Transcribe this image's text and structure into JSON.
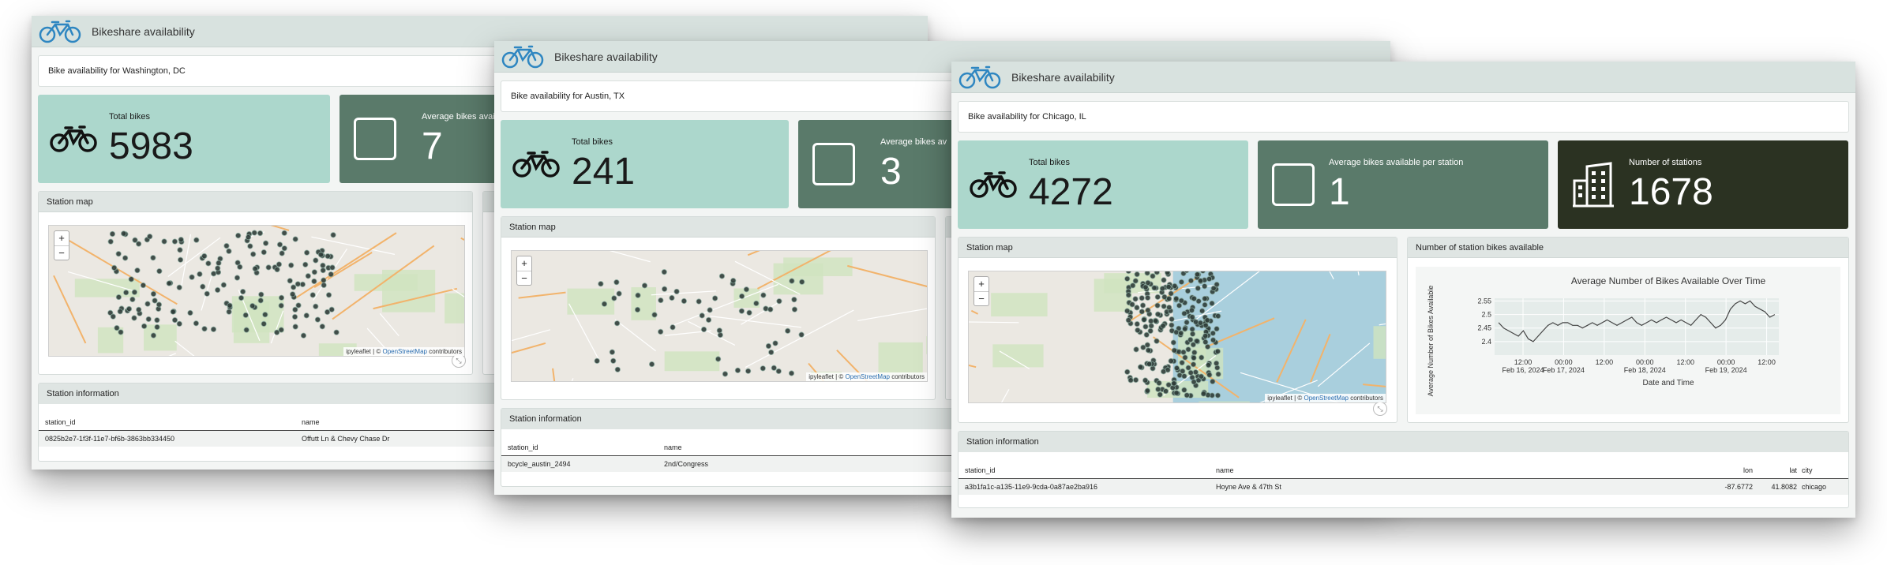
{
  "app": {
    "title": "Bikeshare availability"
  },
  "windows": {
    "dc": {
      "city_label": "Bike availability for Washington, DC",
      "cards": {
        "total_label": "Total bikes",
        "total_value": "5983",
        "avg_label": "Average bikes available per station",
        "avg_value": "7"
      },
      "map_title": "Station map",
      "table": {
        "title": "Station information",
        "columns": [
          "station_id",
          "name"
        ],
        "rows": [
          [
            "0825b2e7-1f3f-11e7-bf6b-3863bb334450",
            "Offutt Ln & Chevy Chase Dr"
          ]
        ]
      }
    },
    "austin": {
      "city_label": "Bike availability for Austin, TX",
      "cards": {
        "total_label": "Total bikes",
        "total_value": "241",
        "avg_label": "Average bikes av",
        "avg_value": "3"
      },
      "map_title": "Station map",
      "table": {
        "title": "Station information",
        "columns": [
          "station_id",
          "name"
        ],
        "rows": [
          [
            "bcycle_austin_2494",
            "2nd/Congress"
          ]
        ]
      }
    },
    "chicago": {
      "city_label": "Bike availability for Chicago, IL",
      "cards": {
        "total_label": "Total bikes",
        "total_value": "4272",
        "avg_label": "Average bikes available per station",
        "avg_value": "1",
        "stations_label": "Number of stations",
        "stations_value": "1678"
      },
      "map_title": "Station map",
      "chart_title_panel": "Number of station bikes available",
      "table": {
        "title": "Station information",
        "columns": [
          "station_id",
          "name",
          "lon",
          "lat",
          "city"
        ],
        "rows": [
          [
            "a3b1fa1c-a135-11e9-9cda-0a87ae2ba916",
            "Hoyne Ave & 47th St",
            "-87.6772",
            "41.8082",
            "chicago"
          ]
        ]
      }
    }
  },
  "map": {
    "zoom_in": "+",
    "zoom_out": "−",
    "attribution_prefix": "ipyleaflet | © ",
    "attribution_link": "OpenStreetMap",
    "attribution_suffix": " contributors",
    "resize_glyph": "⤡"
  },
  "colors": {
    "card_light": "#acd7cc",
    "card_mid": "#5a7a6a",
    "card_dark": "#2b3222",
    "titlebar": "#d8e2df",
    "bike_icon": "#2e86c1",
    "station_marker": "#2f3d39",
    "water": "#a9cfdd"
  },
  "icons": {
    "logo": "bicycle-icon",
    "total": "bicycle-icon",
    "avg": "square-icon",
    "stations": "building-icon"
  },
  "chart_data": {
    "type": "line",
    "title": "Average Number of Bikes Available Over Time",
    "xlabel": "Date and Time",
    "ylabel": "Average Number of Bikes Available",
    "ylim": [
      2.35,
      2.56
    ],
    "yticks": [
      "2.55",
      "2.5",
      "2.45",
      "2.4"
    ],
    "xtick_labels": [
      [
        "12:00",
        "Feb 16, 2024"
      ],
      [
        "00:00",
        "Feb 17, 2024"
      ],
      [
        "12:00",
        ""
      ],
      [
        "00:00",
        "Feb 18, 2024"
      ],
      [
        "12:00",
        ""
      ],
      [
        "00:00",
        "Feb 19, 2024"
      ],
      [
        "12:00",
        ""
      ]
    ],
    "xtick_positions": [
      0,
      1,
      2,
      3,
      4,
      5,
      6
    ],
    "x_range": [
      -0.7,
      6.3
    ],
    "grid": true,
    "series": [
      {
        "values": [
          2.47,
          2.45,
          2.44,
          2.43,
          2.42,
          2.44,
          2.41,
          2.4,
          2.42,
          2.44,
          2.46,
          2.47,
          2.46,
          2.47,
          2.47,
          2.46,
          2.46,
          2.45,
          2.46,
          2.47,
          2.46,
          2.47,
          2.48,
          2.47,
          2.46,
          2.47,
          2.48,
          2.49,
          2.47,
          2.46,
          2.47,
          2.48,
          2.47,
          2.48,
          2.49,
          2.48,
          2.47,
          2.48,
          2.47,
          2.46,
          2.48,
          2.5,
          2.49,
          2.47,
          2.45,
          2.46,
          2.48,
          2.52,
          2.54,
          2.55,
          2.54,
          2.55,
          2.53,
          2.52,
          2.51,
          2.49,
          2.5
        ]
      }
    ]
  }
}
